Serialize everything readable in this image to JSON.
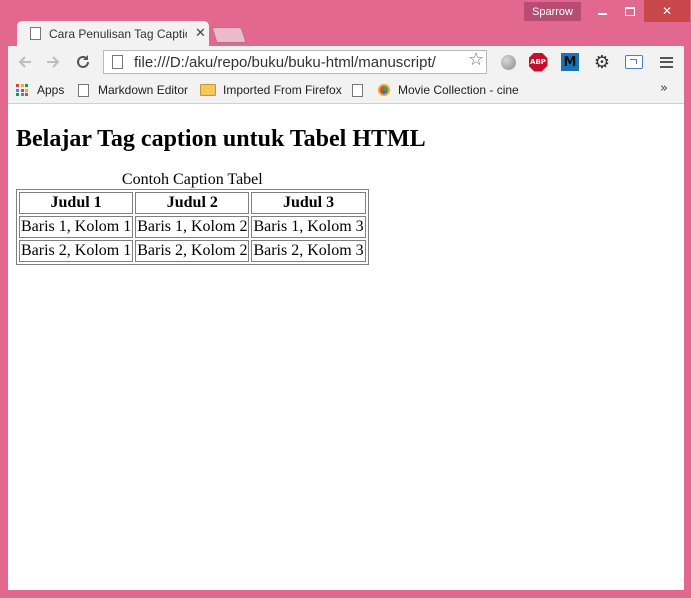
{
  "window": {
    "profile_name": "Sparrow",
    "close_glyph": "✕",
    "tab": {
      "title": "Cara Penulisan Tag Caption",
      "close_glyph": "✕"
    }
  },
  "toolbar": {
    "url": "file:///D:/aku/repo/buku/buku-html/manuscript/",
    "icons": [
      "back-arrow-icon",
      "forward-arrow-icon",
      "reload-icon",
      "page-icon",
      "star-icon",
      "globe-extension-icon",
      "adblock-plus-icon",
      "m-extension-icon",
      "gear-icon",
      "cast-icon",
      "menu-icon"
    ],
    "abp_label": "ABP",
    "m_label": "M"
  },
  "bookmarks": {
    "apps_label": "Apps",
    "items": [
      {
        "label": "Markdown Editor",
        "icon": "page-icon"
      },
      {
        "label": "Imported From Firefox",
        "icon": "folder-icon"
      },
      {
        "label": "",
        "icon": "page-icon"
      },
      {
        "label": "Movie Collection - cine",
        "icon": "movie-icon"
      }
    ],
    "more_glyph": "»",
    "apps_colors": [
      "#d9453b",
      "#f4b400",
      "#0f9d58",
      "#4285f4",
      "#d9453b",
      "#f4b400",
      "#0f9d58",
      "#4285f4",
      "#d9453b"
    ]
  },
  "page": {
    "heading": "Belajar Tag caption untuk Tabel HTML",
    "table": {
      "caption": "Contoh Caption Tabel",
      "headers": [
        "Judul 1",
        "Judul 2",
        "Judul 3"
      ],
      "rows": [
        [
          "Baris 1, Kolom 1",
          "Baris 1, Kolom 2",
          "Baris 1, Kolom 3"
        ],
        [
          "Baris 2, Kolom 1",
          "Baris 2, Kolom 2",
          "Baris 2, Kolom 3"
        ]
      ]
    }
  },
  "colors": {
    "frame": "#e3688f",
    "close_button": "#c9464a",
    "toolbar_bg": "#f2f2f2"
  }
}
